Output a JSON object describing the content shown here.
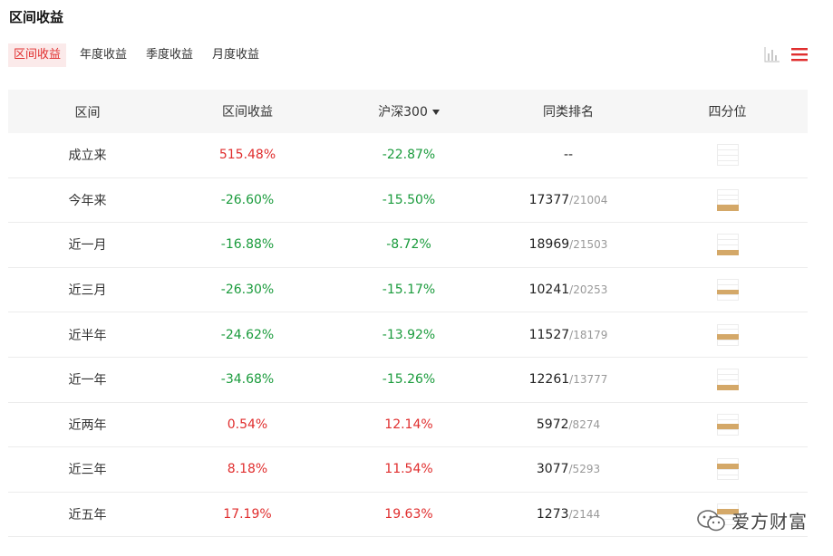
{
  "page": {
    "title": "区间收益"
  },
  "tabs": [
    {
      "label": "区间收益",
      "active": true
    },
    {
      "label": "年度收益",
      "active": false
    },
    {
      "label": "季度收益",
      "active": false
    },
    {
      "label": "月度收益",
      "active": false
    }
  ],
  "view_icons": {
    "chart": "bar-chart-icon",
    "list": "list-icon",
    "accent_color": "#e02e2e"
  },
  "table": {
    "headers": [
      "区间",
      "区间收益",
      "沪深300",
      "同类排名",
      "四分位"
    ],
    "rows": [
      {
        "period": "成立来",
        "return": "515.48%",
        "return_dir": "up",
        "index": "-22.87%",
        "index_dir": "down",
        "rank": "--",
        "rank_total": "",
        "quartile": 0
      },
      {
        "period": "今年来",
        "return": "-26.60%",
        "return_dir": "down",
        "index": "-15.50%",
        "index_dir": "down",
        "rank": "17377",
        "rank_total": "/21004",
        "quartile": 1
      },
      {
        "period": "近一月",
        "return": "-16.88%",
        "return_dir": "down",
        "index": "-8.72%",
        "index_dir": "down",
        "rank": "18969",
        "rank_total": "/21503",
        "quartile": 1
      },
      {
        "period": "近三月",
        "return": "-26.30%",
        "return_dir": "down",
        "index": "-15.17%",
        "index_dir": "down",
        "rank": "10241",
        "rank_total": "/20253",
        "quartile": 2
      },
      {
        "period": "近半年",
        "return": "-24.62%",
        "return_dir": "down",
        "index": "-13.92%",
        "index_dir": "down",
        "rank": "11527",
        "rank_total": "/18179",
        "quartile": 2
      },
      {
        "period": "近一年",
        "return": "-34.68%",
        "return_dir": "down",
        "index": "-15.26%",
        "index_dir": "down",
        "rank": "12261",
        "rank_total": "/13777",
        "quartile": 1
      },
      {
        "period": "近两年",
        "return": "0.54%",
        "return_dir": "up",
        "index": "12.14%",
        "index_dir": "up",
        "rank": "5972",
        "rank_total": "/8274",
        "quartile": 2
      },
      {
        "period": "近三年",
        "return": "8.18%",
        "return_dir": "up",
        "index": "11.54%",
        "index_dir": "up",
        "rank": "3077",
        "rank_total": "/5293",
        "quartile": 3
      },
      {
        "period": "近五年",
        "return": "17.19%",
        "return_dir": "up",
        "index": "19.63%",
        "index_dir": "up",
        "rank": "1273",
        "rank_total": "/2144",
        "quartile": 3
      }
    ]
  },
  "watermark": {
    "text": "爱方财富",
    "icon": "wechat-icon"
  }
}
